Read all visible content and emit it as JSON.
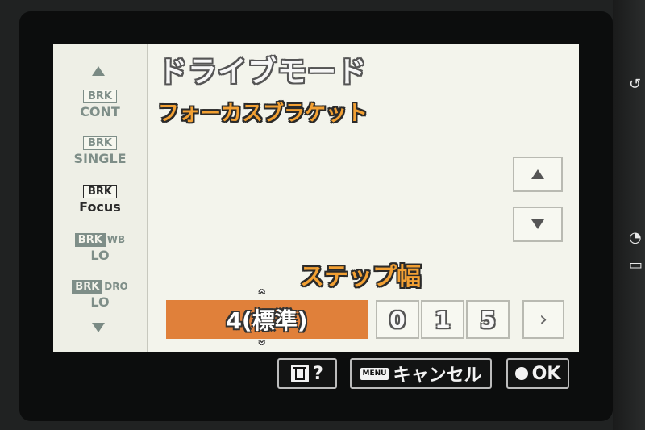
{
  "screen": {
    "title": "ドライブモード",
    "subtitle": "フォーカスブラケット"
  },
  "sidebar": {
    "modes": [
      {
        "badge": "BRK",
        "label": "CONT",
        "side": "",
        "selected": false
      },
      {
        "badge": "BRK",
        "label": "SINGLE",
        "side": "",
        "selected": false
      },
      {
        "badge": "BRK",
        "label": "Focus",
        "side": "",
        "selected": true
      },
      {
        "badge": "BRK",
        "label": "LO",
        "side": "WB",
        "selected": false
      },
      {
        "badge": "BRK",
        "label": "LO",
        "side": "DRO",
        "selected": false
      }
    ]
  },
  "step": {
    "label": "ステップ幅",
    "value": "4(標準)",
    "digits": [
      "0",
      "1",
      "5"
    ],
    "next": "›"
  },
  "bottom_bar": {
    "help_label": "?",
    "menu_chip": "MENU",
    "cancel_label": "キャンセル",
    "ok_label": "OK"
  },
  "colors": {
    "screen_bg": "#f3f4ec",
    "accent_orange": "#e0803a",
    "subtitle_orange": "#f2a033",
    "bar_bg": "#0c0d0d"
  }
}
